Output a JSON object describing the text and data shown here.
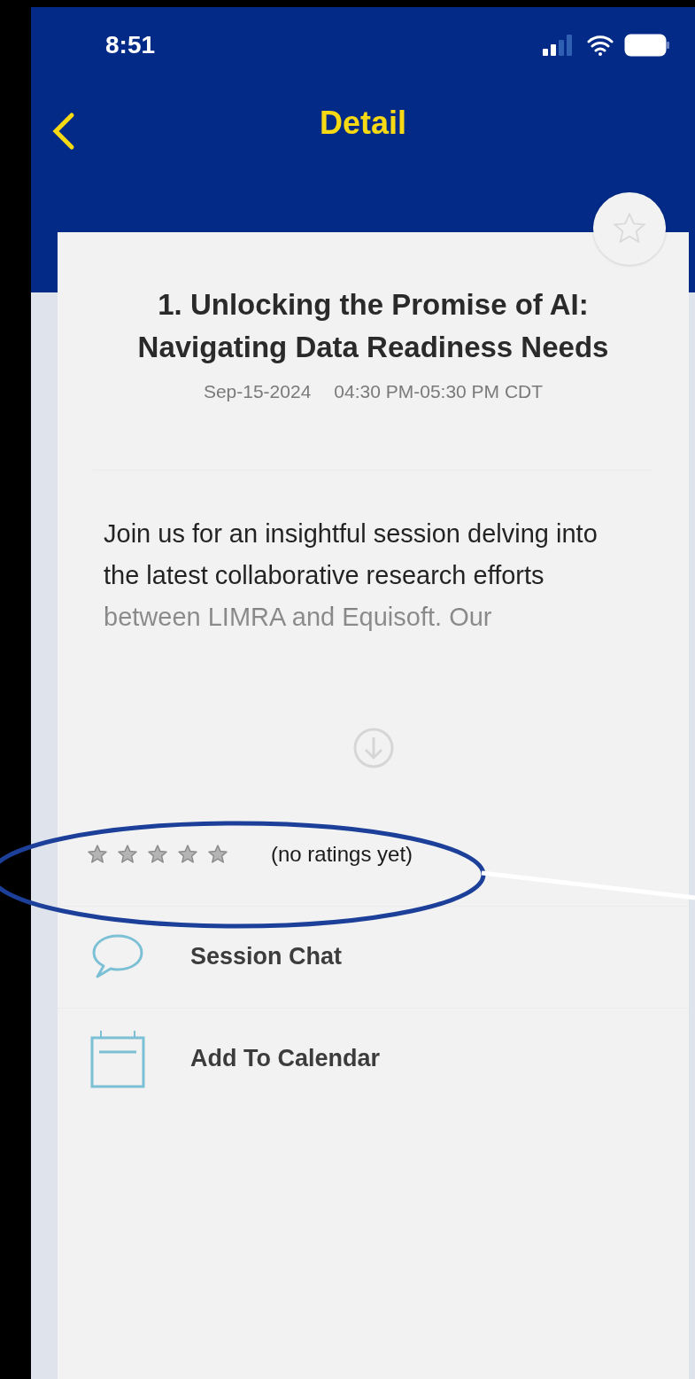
{
  "status_bar": {
    "time": "8:51"
  },
  "header": {
    "title": "Detail"
  },
  "session": {
    "favorite": false,
    "title": "1. Unlocking the Promise of AI: Navigating Data Readiness Needs",
    "date": "Sep-15-2024",
    "time": "04:30 PM-05:30 PM CDT",
    "description": "Join us for an insightful session delving into the latest collaborative research efforts between LIMRA and Equisoft. Our"
  },
  "rating": {
    "stars": 0,
    "text": "(no ratings yet)"
  },
  "actions": [
    {
      "kind": "chat",
      "label": "Session Chat"
    },
    {
      "kind": "calendar",
      "label": "Add To Calendar"
    }
  ]
}
